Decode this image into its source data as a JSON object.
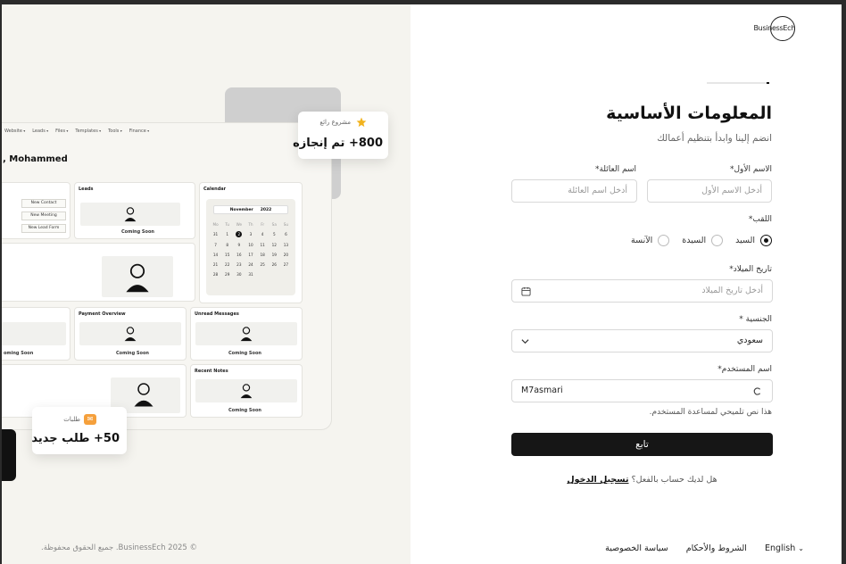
{
  "preview": {
    "nav_items": [
      "Website",
      "Leads",
      "Files",
      "Templates",
      "Tools",
      "Finance"
    ],
    "greeting": ", Mohammed",
    "cards": {
      "leads_title": "Leads",
      "calendar_title": "Calendar",
      "payment_title": "Payment Overview",
      "unread_title": "Unread Messages",
      "notes_title": "Recent Notes",
      "coming_soon": "Coming Soon",
      "coming_soon_partial": "oming Soon"
    },
    "quick_actions": [
      "New Contact",
      "New Meeting",
      "New Lead Form"
    ],
    "calendar": {
      "month": "November",
      "year": "2022",
      "weekdays": [
        "Mo",
        "Tu",
        "We",
        "Th",
        "Fr",
        "Sa",
        "Su"
      ],
      "days": [
        "31",
        "1",
        "2",
        "3",
        "4",
        "5",
        "6",
        "7",
        "8",
        "9",
        "10",
        "11",
        "12",
        "13",
        "14",
        "15",
        "16",
        "17",
        "18",
        "19",
        "20",
        "21",
        "22",
        "23",
        "24",
        "25",
        "26",
        "27",
        "28",
        "29",
        "30",
        "31"
      ],
      "selected": "2"
    },
    "floater_top": {
      "label": "مشروع رائع",
      "value": "800+ تم إنجازه"
    },
    "floater_bottom": {
      "label": "طلبات",
      "value": "50+ طلب جديد"
    },
    "copyright": "© 2025 BusinessEch. جميع الحقوق محفوظة."
  },
  "brand": {
    "logo_text": "BusinessEch"
  },
  "progress": {
    "fraction": 0.05
  },
  "form": {
    "title": "المعلومات الأساسية",
    "subtitle": "انضم إلينا وابدأ بتنظيم أعمالك",
    "first_name": {
      "label": "الاسم الأول*",
      "placeholder": "أدخل الاسم الأول"
    },
    "last_name": {
      "label": "اسم العائلة*",
      "placeholder": "أدخل اسم العائلة"
    },
    "title_field": {
      "label": "اللقب*",
      "options": [
        "السيد",
        "السيدة",
        "الآنسة"
      ],
      "selected": "السيد"
    },
    "birthdate": {
      "label": "تاريخ الميلاد*",
      "placeholder": "أدخل تاريخ الميلاد",
      "icon": "calendar-icon"
    },
    "nationality": {
      "label": "الجنسية *",
      "value": "سعودي",
      "icon": "chevron-down-icon"
    },
    "username": {
      "label": "اسم المستخدم*",
      "value": "M7asmari",
      "icon": "loading-spinner-icon"
    },
    "hint": "هذا نص تلميحي لمساعدة المستخدم.",
    "submit_label": "تابع",
    "signin_prompt": "هل لديك حساب بالفعل؟",
    "signin_link": "تسجيل الدخول"
  },
  "footer": {
    "language": "English",
    "terms": "الشروط والأحكام",
    "privacy": "سياسة الخصوصية"
  },
  "colors": {
    "accent": "#161616",
    "background_left": "#f5f4ef",
    "badge_orange": "#f5a03c",
    "star": "#f2b31e"
  }
}
